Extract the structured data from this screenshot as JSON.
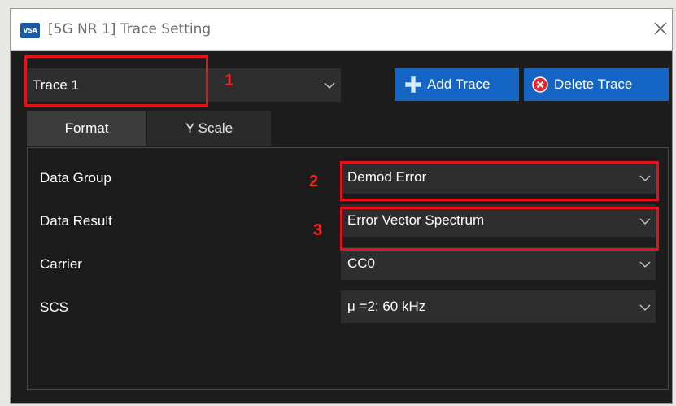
{
  "window": {
    "title": "[5G NR 1] Trace Setting",
    "app_icon_text": "VSA"
  },
  "trace": {
    "selected": "Trace 1"
  },
  "buttons": {
    "add_trace": "Add Trace",
    "delete_trace": "Delete Trace"
  },
  "tabs": [
    {
      "label": "Format",
      "active": true
    },
    {
      "label": "Y Scale",
      "active": false
    }
  ],
  "fields": [
    {
      "label": "Data Group",
      "value": "Demod Error"
    },
    {
      "label": "Data Result",
      "value": "Error Vector Spectrum"
    },
    {
      "label": "Carrier",
      "value": "CC0"
    },
    {
      "label": "SCS",
      "value": "μ =2: 60 kHz"
    }
  ],
  "annotations": {
    "callout_1": "1",
    "callout_2": "2",
    "callout_3": "3"
  },
  "colors": {
    "accent_button": "#1565c4",
    "callout_red": "#e8101a",
    "dialog_background": "#1c1c1c"
  }
}
